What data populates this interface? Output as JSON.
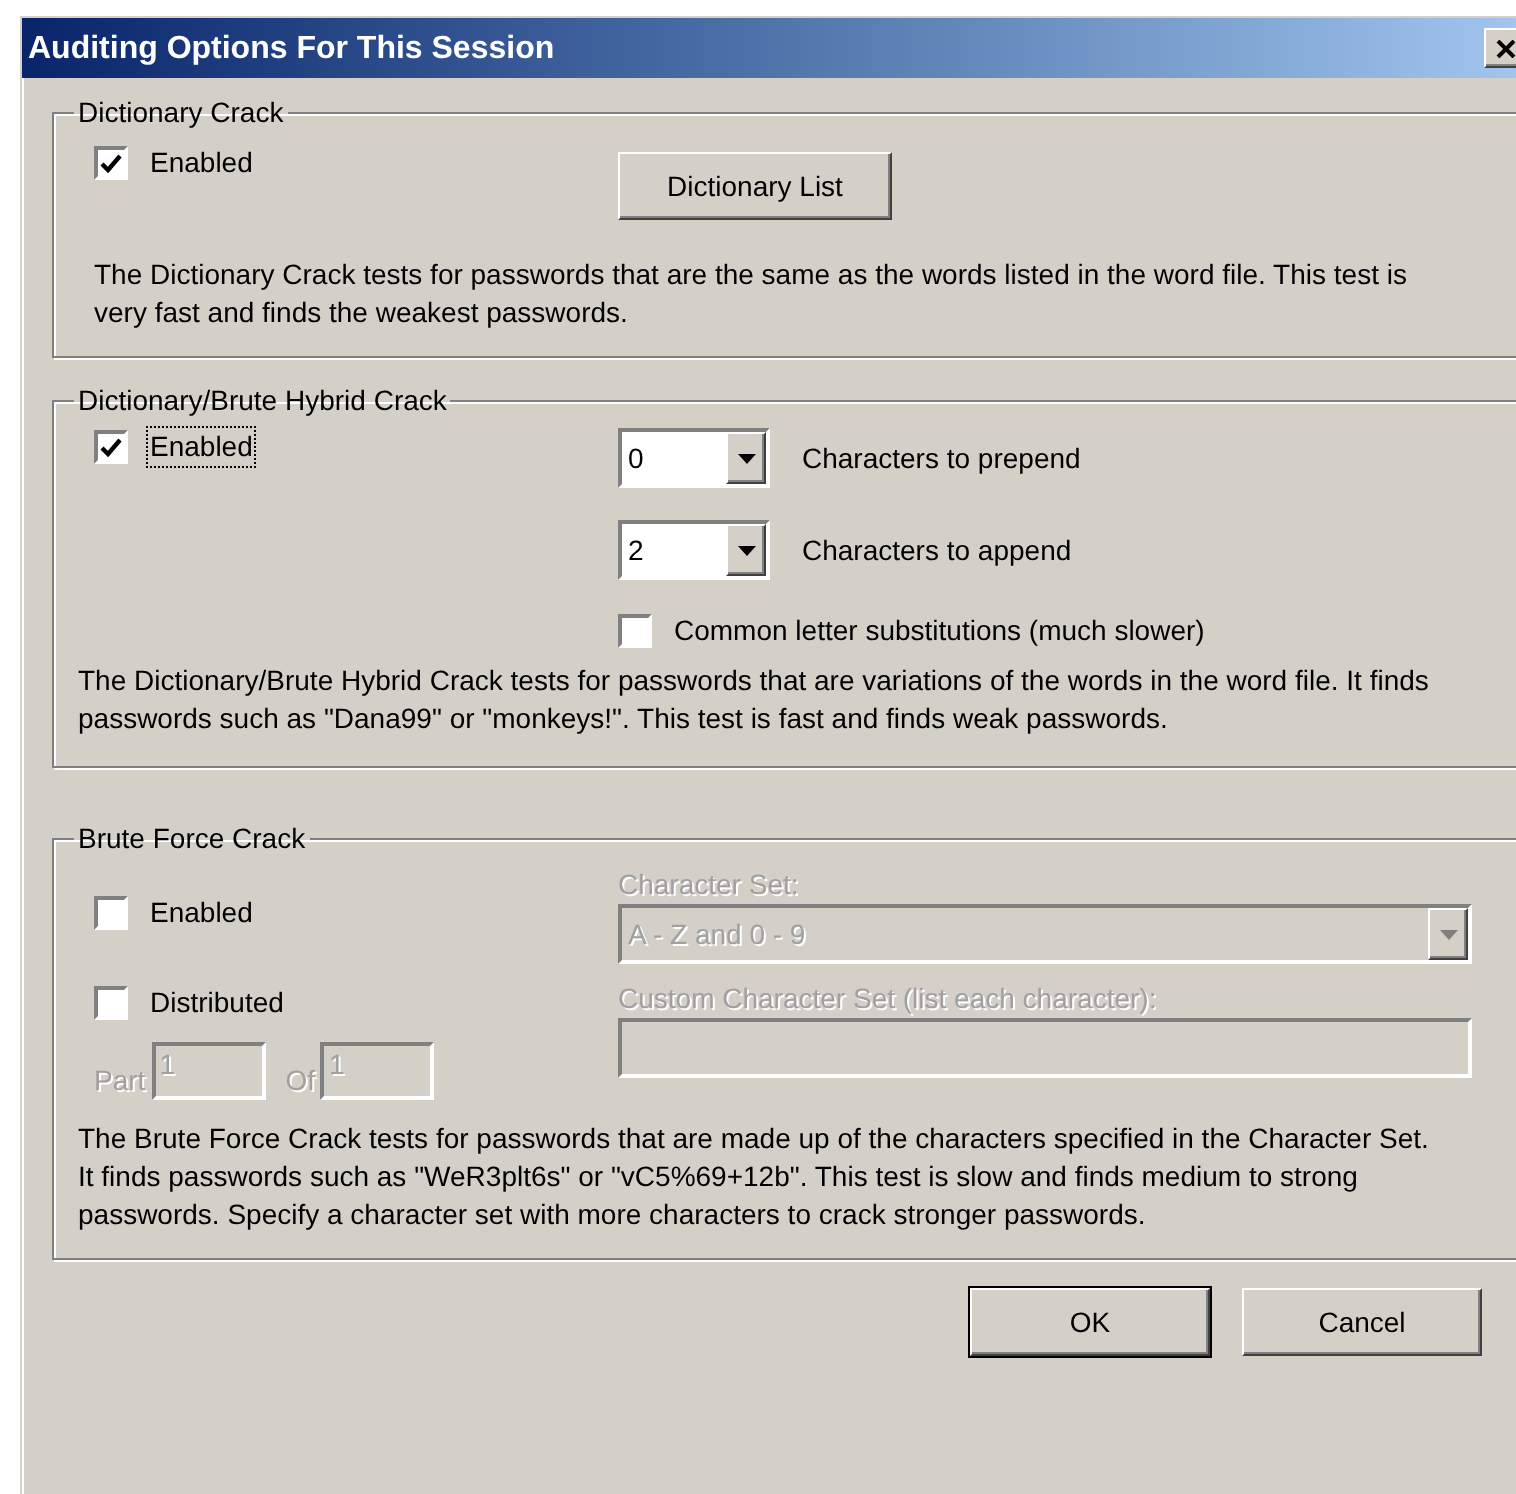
{
  "window": {
    "title": "Auditing Options For This Session"
  },
  "dictionary": {
    "title": "Dictionary Crack",
    "enabled": {
      "label": "Enabled",
      "checked": true,
      "focused": false
    },
    "button": "Dictionary List",
    "description": "The Dictionary Crack tests for passwords that are the same as the words listed in the word file.  This test is very fast and finds the weakest passwords."
  },
  "hybrid": {
    "title": "Dictionary/Brute Hybrid Crack",
    "enabled": {
      "label": "Enabled",
      "checked": true,
      "focused": true
    },
    "prepend": {
      "value": "0",
      "label": "Characters to prepend"
    },
    "append": {
      "value": "2",
      "label": "Characters to append"
    },
    "substitutions": {
      "label": "Common letter substitutions (much slower)",
      "checked": false,
      "focused": false
    },
    "description": "The Dictionary/Brute Hybrid Crack tests for passwords that are variations of the words in the word file. It finds passwords such as \"Dana99\" or \"monkeys!\". This test is fast and finds weak passwords."
  },
  "brute": {
    "title": "Brute Force Crack",
    "enabled": {
      "label": "Enabled",
      "checked": false,
      "focused": false
    },
    "distributed": {
      "label": "Distributed",
      "checked": false,
      "focused": false
    },
    "part": {
      "label": "Part",
      "value": "1",
      "disabled": true
    },
    "of": {
      "label": "Of",
      "value": "1",
      "disabled": true
    },
    "character_set": {
      "label": "Character Set:",
      "value": "A - Z and 0 - 9",
      "disabled": true
    },
    "custom_set": {
      "label": "Custom Character Set (list each character):",
      "disabled": true
    },
    "description": "The Brute Force Crack tests for passwords that are made up of the characters specified in the Character Set. It finds passwords such as \"WeR3plt6s\" or \"vC5%69+12b\". This test is slow and finds medium to strong passwords. Specify a character set with more characters to crack stronger passwords."
  },
  "buttons": [
    {
      "label": "OK",
      "default": true
    },
    {
      "label": "Cancel",
      "default": false
    }
  ]
}
